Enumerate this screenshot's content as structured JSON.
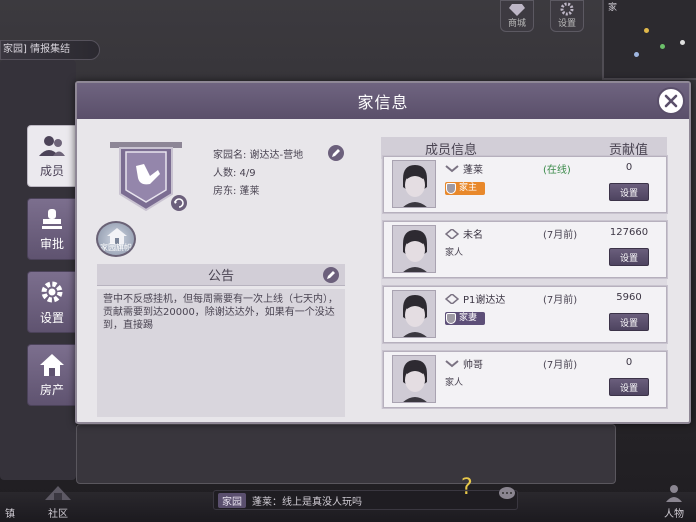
{
  "hud": {
    "shop_label": "商城",
    "settings_label": "设置",
    "breadcrumb": "家园] 情报集结",
    "minimap_title": "家",
    "bottom_left_label": "镇",
    "community_label": "社区",
    "right_bottom_label": "人物"
  },
  "chat": {
    "channel": "家园",
    "message": "蓬莱：线上是真没人玩吗"
  },
  "dialog": {
    "title": "家信息"
  },
  "tabs": [
    {
      "label": "成员",
      "icon": "members-icon",
      "active": true
    },
    {
      "label": "审批",
      "icon": "stamp-icon",
      "active": false
    },
    {
      "label": "设置",
      "icon": "gear-icon",
      "active": false
    },
    {
      "label": "房产",
      "icon": "house-icon",
      "active": false
    }
  ],
  "home": {
    "name_line": "家园名: 谢达达-营地",
    "count_line": "人数:  4/9",
    "owner_line": "房东:  蓬莱",
    "badge_label": "家园旗帜"
  },
  "notice": {
    "title": "公告",
    "text": "营中不反感挂机，但每周需要有一次上线（七天内），贡献需要到达20000，除谢达达外，如果有一个没达到，直接踢"
  },
  "members": {
    "header_info": "成员信息",
    "header_contrib": "贡献值",
    "items": [
      {
        "name": "蓬莱",
        "status": "(在线)",
        "role": "家主",
        "contribution": "0",
        "button": "设置"
      },
      {
        "name": "未名",
        "status": "(7月前)",
        "role": "家人",
        "contribution": "127660",
        "button": "设置"
      },
      {
        "name": "P1谢达达",
        "status": "(7月前)",
        "role": "家妻",
        "contribution": "5960",
        "button": "设置"
      },
      {
        "name": "帅哥",
        "status": "(7月前)",
        "role": "家人",
        "contribution": "0",
        "button": "设置"
      }
    ]
  },
  "colors": {
    "header_purple": "#5a4f6a",
    "host_orange": "#e8882a",
    "spouse_purple": "#5d4f78",
    "online_green": "#3a8a49"
  }
}
